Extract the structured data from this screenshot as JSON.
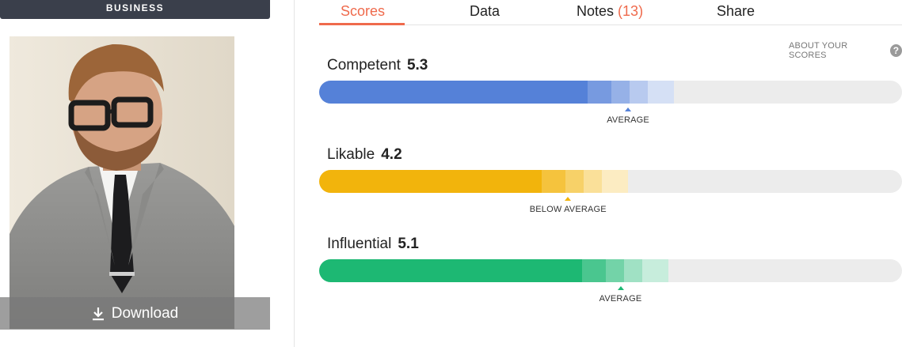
{
  "left": {
    "category": "BUSINESS",
    "download_label": "Download"
  },
  "tabs": [
    {
      "label": "Scores",
      "active": true
    },
    {
      "label": "Data",
      "active": false
    },
    {
      "label": "Notes",
      "count": "(13)",
      "active": false
    },
    {
      "label": "Share",
      "active": false
    }
  ],
  "about_scores": "ABOUT YOUR SCORES",
  "help_glyph": "?",
  "scores": [
    {
      "name": "Competent",
      "value": "5.3",
      "color": "#5581d8",
      "fill_fraction": 0.46,
      "marker_label": "AVERAGE",
      "marker_fraction": 0.53
    },
    {
      "name": "Likable",
      "value": "4.2",
      "color": "#f2b40c",
      "fill_fraction": 0.382,
      "marker_label": "BELOW AVERAGE",
      "marker_fraction": 0.427
    },
    {
      "name": "Influential",
      "value": "5.1",
      "color": "#1db873",
      "fill_fraction": 0.451,
      "marker_label": "AVERAGE",
      "marker_fraction": 0.517
    }
  ]
}
